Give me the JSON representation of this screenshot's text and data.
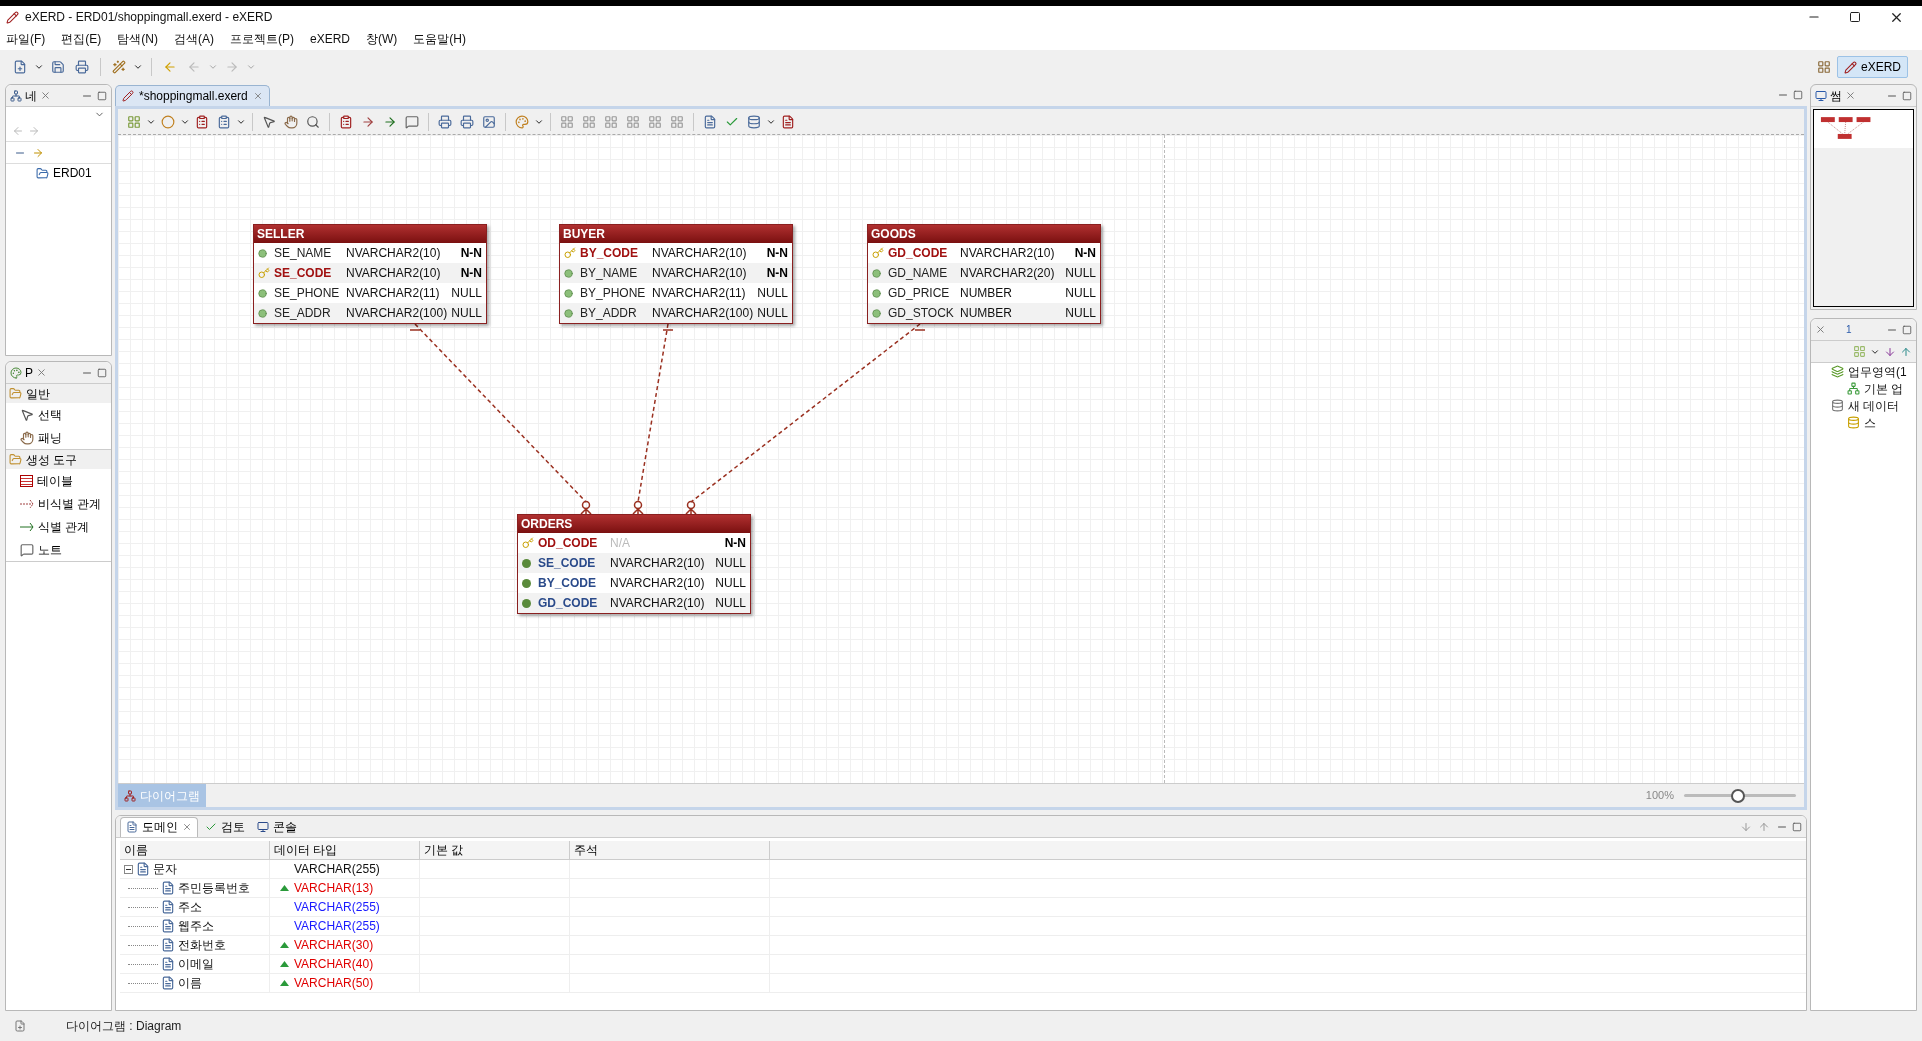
{
  "window": {
    "title": "eXERD - ERD01/shoppingmall.exerd - eXERD"
  },
  "menu": [
    "파일(F)",
    "편집(E)",
    "탐색(N)",
    "검색(A)",
    "프로젝트(P)",
    "eXERD",
    "창(W)",
    "도움말(H)"
  ],
  "perspective": {
    "label": "eXERD",
    "selected": true
  },
  "navigator": {
    "tab": "네",
    "tree": [
      {
        "label": "ERD01"
      }
    ]
  },
  "palette": {
    "tab": "P",
    "groups": [
      {
        "label": "일반",
        "items": [
          {
            "label": "선택",
            "kind": "select"
          },
          {
            "label": "패닝",
            "kind": "pan"
          }
        ]
      },
      {
        "label": "생성 도구",
        "items": [
          {
            "label": "테이블",
            "kind": "table"
          },
          {
            "label": "비식별 관계",
            "kind": "non_identifying"
          },
          {
            "label": "식별 관계",
            "kind": "identifying"
          },
          {
            "label": "노트",
            "kind": "note"
          }
        ]
      }
    ]
  },
  "editor": {
    "tab": "*shoppingmall.exerd",
    "entities": [
      {
        "name": "SELLER",
        "columns": [
          {
            "name": "SE_NAME",
            "type": "NVARCHAR2(10)",
            "nullability": "N-N",
            "kind": "column",
            "not_null": true,
            "type_undefined": false
          },
          {
            "name": "SE_CODE",
            "type": "NVARCHAR2(10)",
            "nullability": "N-N",
            "kind": "pk",
            "not_null": true,
            "type_undefined": false
          },
          {
            "name": "SE_PHONE",
            "type": "NVARCHAR2(11)",
            "nullability": "NULL",
            "kind": "column",
            "not_null": false,
            "type_undefined": false
          },
          {
            "name": "SE_ADDR",
            "type": "NVARCHAR2(100)",
            "nullability": "NULL",
            "kind": "column",
            "not_null": false,
            "type_undefined": false
          }
        ]
      },
      {
        "name": "BUYER",
        "columns": [
          {
            "name": "BY_CODE",
            "type": "NVARCHAR2(10)",
            "nullability": "N-N",
            "kind": "pk",
            "not_null": true,
            "type_undefined": false
          },
          {
            "name": "BY_NAME",
            "type": "NVARCHAR2(10)",
            "nullability": "N-N",
            "kind": "column",
            "not_null": true,
            "type_undefined": false
          },
          {
            "name": "BY_PHONE",
            "type": "NVARCHAR2(11)",
            "nullability": "NULL",
            "kind": "column",
            "not_null": false,
            "type_undefined": false
          },
          {
            "name": "BY_ADDR",
            "type": "NVARCHAR2(100)",
            "nullability": "NULL",
            "kind": "column",
            "not_null": false,
            "type_undefined": false
          }
        ]
      },
      {
        "name": "GOODS",
        "columns": [
          {
            "name": "GD_CODE",
            "type": "NVARCHAR2(10)",
            "nullability": "N-N",
            "kind": "pk",
            "not_null": true,
            "type_undefined": false
          },
          {
            "name": "GD_NAME",
            "type": "NVARCHAR2(20)",
            "nullability": "NULL",
            "kind": "column",
            "not_null": false,
            "type_undefined": false
          },
          {
            "name": "GD_PRICE",
            "type": "NUMBER",
            "nullability": "NULL",
            "kind": "column",
            "not_null": false,
            "type_undefined": false
          },
          {
            "name": "GD_STOCK",
            "type": "NUMBER",
            "nullability": "NULL",
            "kind": "column",
            "not_null": false,
            "type_undefined": false
          }
        ]
      },
      {
        "name": "ORDERS",
        "columns": [
          {
            "name": "OD_CODE",
            "type": "N/A",
            "nullability": "N-N",
            "kind": "pk",
            "not_null": true,
            "type_undefined": true
          },
          {
            "name": "SE_CODE",
            "type": "NVARCHAR2(10)",
            "nullability": "NULL",
            "kind": "fk",
            "not_null": false,
            "type_undefined": false
          },
          {
            "name": "BY_CODE",
            "type": "NVARCHAR2(10)",
            "nullability": "NULL",
            "kind": "fk",
            "not_null": false,
            "type_undefined": false
          },
          {
            "name": "GD_CODE",
            "type": "NVARCHAR2(10)",
            "nullability": "NULL",
            "kind": "fk",
            "not_null": false,
            "type_undefined": false
          }
        ]
      }
    ],
    "footer_tab": "다이어그램",
    "zoom": {
      "reading": "100%",
      "level": 0.48
    }
  },
  "domain_panel": {
    "tabs": [
      {
        "label": "도메인",
        "selected": true,
        "kind": "domain"
      },
      {
        "label": "검토",
        "selected": false,
        "kind": "review"
      },
      {
        "label": "콘솔",
        "selected": false,
        "kind": "console"
      }
    ],
    "columns": [
      "이름",
      "데이터 타입",
      "기본 값",
      "주석"
    ],
    "rows": [
      {
        "name": "문자",
        "data_type": "VARCHAR(255)",
        "expanded": true,
        "children": [
          {
            "name": "주민등록번호",
            "data_type": "VARCHAR(13)",
            "kind": "modified"
          },
          {
            "name": "주소",
            "data_type": "VARCHAR(255)",
            "kind": "inherited"
          },
          {
            "name": "웹주소",
            "data_type": "VARCHAR(255)",
            "kind": "inherited"
          },
          {
            "name": "전화번호",
            "data_type": "VARCHAR(30)",
            "kind": "modified"
          },
          {
            "name": "이메일",
            "data_type": "VARCHAR(40)",
            "kind": "modified"
          },
          {
            "name": "이름",
            "data_type": "VARCHAR(50)",
            "kind": "modified"
          }
        ]
      }
    ]
  },
  "outline": {
    "tab": "썸"
  },
  "model_panel": {
    "overflow_count": "1",
    "tree": [
      {
        "label": "업무영역(1",
        "kind": "area",
        "children": [
          {
            "label": "기본 업",
            "kind": "subarea"
          }
        ]
      },
      {
        "label": "새 데이터",
        "kind": "database",
        "children": [
          {
            "label": "스",
            "kind": "schema"
          }
        ]
      }
    ]
  },
  "status_bar": {
    "text": "다이어그램 : Diagram"
  }
}
